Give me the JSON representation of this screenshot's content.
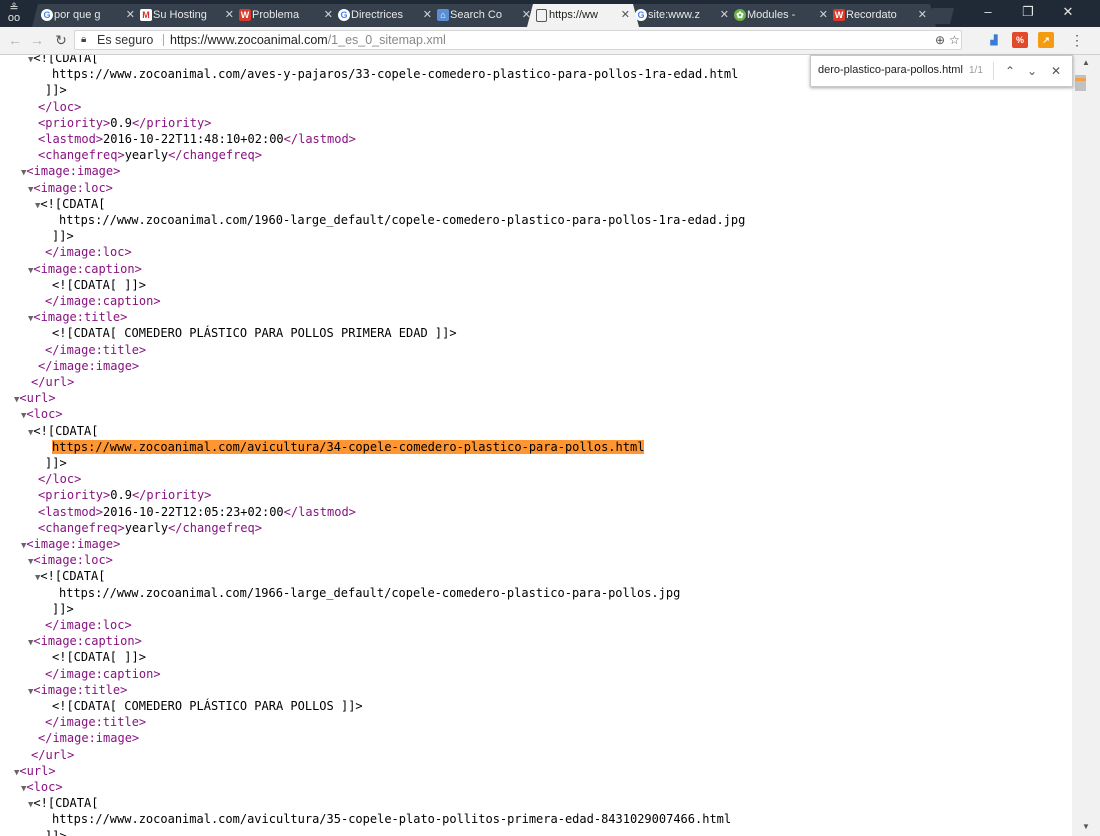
{
  "browser": {
    "tabs": [
      {
        "title": "por que g",
        "favicon": "google-icon"
      },
      {
        "title": "Su Hosting",
        "favicon": "gmail-icon"
      },
      {
        "title": "Problema",
        "favicon": "w-icon"
      },
      {
        "title": "Directrices",
        "favicon": "google-icon"
      },
      {
        "title": "Search Co",
        "favicon": "search-console-icon"
      },
      {
        "title": "https://ww",
        "favicon": "document-icon",
        "active": true
      },
      {
        "title": "site:www.z",
        "favicon": "google-icon"
      },
      {
        "title": "Modules -",
        "favicon": "modules-icon"
      },
      {
        "title": "Recordato",
        "favicon": "w-icon"
      }
    ],
    "omnibox": {
      "security_label": "Es seguro",
      "url_host": "https://www.zocoanimal.com",
      "url_path": "/1_es_0_sitemap.xml"
    },
    "find_bar": {
      "query": "dero-plastico-para-pollos.html",
      "count": "1/1"
    }
  },
  "xml_lines": [
    {
      "indent": 4,
      "tri": true,
      "parts": [
        {
          "k": "p",
          "t": "<![CDATA["
        }
      ]
    },
    {
      "indent": 6,
      "parts": [
        {
          "k": "p",
          "t": "https://www.zocoanimal.com/aves-y-pajaros/33-copele-comedero-plastico-para-pollos-1ra-edad.html"
        }
      ]
    },
    {
      "indent": 5,
      "parts": [
        {
          "k": "p",
          "t": "]]>"
        }
      ]
    },
    {
      "indent": 4,
      "parts": [
        {
          "k": "t",
          "t": "</loc>"
        }
      ]
    },
    {
      "indent": 4,
      "parts": [
        {
          "k": "t",
          "t": "<priority>"
        },
        {
          "k": "p",
          "t": "0.9"
        },
        {
          "k": "t",
          "t": "</priority>"
        }
      ]
    },
    {
      "indent": 4,
      "parts": [
        {
          "k": "t",
          "t": "<lastmod>"
        },
        {
          "k": "p",
          "t": "2016-10-22T11:48:10+02:00"
        },
        {
          "k": "t",
          "t": "</lastmod>"
        }
      ]
    },
    {
      "indent": 4,
      "parts": [
        {
          "k": "t",
          "t": "<changefreq>"
        },
        {
          "k": "p",
          "t": "yearly"
        },
        {
          "k": "t",
          "t": "</changefreq>"
        }
      ]
    },
    {
      "indent": 3,
      "tri": true,
      "parts": [
        {
          "k": "t",
          "t": "<image:image>"
        }
      ]
    },
    {
      "indent": 4,
      "tri": true,
      "parts": [
        {
          "k": "t",
          "t": "<image:loc>"
        }
      ]
    },
    {
      "indent": 5,
      "tri": true,
      "parts": [
        {
          "k": "p",
          "t": "<![CDATA["
        }
      ]
    },
    {
      "indent": 7,
      "parts": [
        {
          "k": "p",
          "t": "https://www.zocoanimal.com/1960-large_default/copele-comedero-plastico-para-pollos-1ra-edad.jpg"
        }
      ]
    },
    {
      "indent": 6,
      "parts": [
        {
          "k": "p",
          "t": "]]>"
        }
      ]
    },
    {
      "indent": 5,
      "parts": [
        {
          "k": "t",
          "t": "</image:loc>"
        }
      ]
    },
    {
      "indent": 4,
      "tri": true,
      "parts": [
        {
          "k": "t",
          "t": "<image:caption>"
        }
      ]
    },
    {
      "indent": 6,
      "parts": [
        {
          "k": "p",
          "t": "<![CDATA[ ]]>"
        }
      ]
    },
    {
      "indent": 5,
      "parts": [
        {
          "k": "t",
          "t": "</image:caption>"
        }
      ]
    },
    {
      "indent": 4,
      "tri": true,
      "parts": [
        {
          "k": "t",
          "t": "<image:title>"
        }
      ]
    },
    {
      "indent": 6,
      "parts": [
        {
          "k": "p",
          "t": "<![CDATA[ COMEDERO PLÁSTICO PARA POLLOS PRIMERA EDAD ]]>"
        }
      ]
    },
    {
      "indent": 5,
      "parts": [
        {
          "k": "t",
          "t": "</image:title>"
        }
      ]
    },
    {
      "indent": 4,
      "parts": [
        {
          "k": "t",
          "t": "</image:image>"
        }
      ]
    },
    {
      "indent": 3,
      "parts": [
        {
          "k": "t",
          "t": "</url>"
        }
      ]
    },
    {
      "indent": 2,
      "tri": true,
      "parts": [
        {
          "k": "t",
          "t": "<url>"
        }
      ]
    },
    {
      "indent": 3,
      "tri": true,
      "parts": [
        {
          "k": "t",
          "t": "<loc>"
        }
      ]
    },
    {
      "indent": 4,
      "tri": true,
      "parts": [
        {
          "k": "p",
          "t": "<![CDATA["
        }
      ]
    },
    {
      "indent": 6,
      "parts": [
        {
          "k": "h",
          "t": "https://www.zocoanimal.com/avicultura/34-copele-comedero-plastico-para-pollos.html"
        }
      ]
    },
    {
      "indent": 5,
      "parts": [
        {
          "k": "p",
          "t": "]]>"
        }
      ]
    },
    {
      "indent": 4,
      "parts": [
        {
          "k": "t",
          "t": "</loc>"
        }
      ]
    },
    {
      "indent": 4,
      "parts": [
        {
          "k": "t",
          "t": "<priority>"
        },
        {
          "k": "p",
          "t": "0.9"
        },
        {
          "k": "t",
          "t": "</priority>"
        }
      ]
    },
    {
      "indent": 4,
      "parts": [
        {
          "k": "t",
          "t": "<lastmod>"
        },
        {
          "k": "p",
          "t": "2016-10-22T12:05:23+02:00"
        },
        {
          "k": "t",
          "t": "</lastmod>"
        }
      ]
    },
    {
      "indent": 4,
      "parts": [
        {
          "k": "t",
          "t": "<changefreq>"
        },
        {
          "k": "p",
          "t": "yearly"
        },
        {
          "k": "t",
          "t": "</changefreq>"
        }
      ]
    },
    {
      "indent": 3,
      "tri": true,
      "parts": [
        {
          "k": "t",
          "t": "<image:image>"
        }
      ]
    },
    {
      "indent": 4,
      "tri": true,
      "parts": [
        {
          "k": "t",
          "t": "<image:loc>"
        }
      ]
    },
    {
      "indent": 5,
      "tri": true,
      "parts": [
        {
          "k": "p",
          "t": "<![CDATA["
        }
      ]
    },
    {
      "indent": 7,
      "parts": [
        {
          "k": "p",
          "t": "https://www.zocoanimal.com/1966-large_default/copele-comedero-plastico-para-pollos.jpg"
        }
      ]
    },
    {
      "indent": 6,
      "parts": [
        {
          "k": "p",
          "t": "]]>"
        }
      ]
    },
    {
      "indent": 5,
      "parts": [
        {
          "k": "t",
          "t": "</image:loc>"
        }
      ]
    },
    {
      "indent": 4,
      "tri": true,
      "parts": [
        {
          "k": "t",
          "t": "<image:caption>"
        }
      ]
    },
    {
      "indent": 6,
      "parts": [
        {
          "k": "p",
          "t": "<![CDATA[ ]]>"
        }
      ]
    },
    {
      "indent": 5,
      "parts": [
        {
          "k": "t",
          "t": "</image:caption>"
        }
      ]
    },
    {
      "indent": 4,
      "tri": true,
      "parts": [
        {
          "k": "t",
          "t": "<image:title>"
        }
      ]
    },
    {
      "indent": 6,
      "parts": [
        {
          "k": "p",
          "t": "<![CDATA[ COMEDERO PLÁSTICO PARA POLLOS ]]>"
        }
      ]
    },
    {
      "indent": 5,
      "parts": [
        {
          "k": "t",
          "t": "</image:title>"
        }
      ]
    },
    {
      "indent": 4,
      "parts": [
        {
          "k": "t",
          "t": "</image:image>"
        }
      ]
    },
    {
      "indent": 3,
      "parts": [
        {
          "k": "t",
          "t": "</url>"
        }
      ]
    },
    {
      "indent": 2,
      "tri": true,
      "parts": [
        {
          "k": "t",
          "t": "<url>"
        }
      ]
    },
    {
      "indent": 3,
      "tri": true,
      "parts": [
        {
          "k": "t",
          "t": "<loc>"
        }
      ]
    },
    {
      "indent": 4,
      "tri": true,
      "parts": [
        {
          "k": "p",
          "t": "<![CDATA["
        }
      ]
    },
    {
      "indent": 6,
      "parts": [
        {
          "k": "p",
          "t": "https://www.zocoanimal.com/avicultura/35-copele-plato-pollitos-primera-edad-8431029007466.html"
        }
      ]
    },
    {
      "indent": 5,
      "parts": [
        {
          "k": "p",
          "t": "]]>"
        }
      ]
    }
  ],
  "colors": {
    "tag": "#881280",
    "highlight": "#ff9632",
    "tabstrip": "#1f2a36"
  }
}
